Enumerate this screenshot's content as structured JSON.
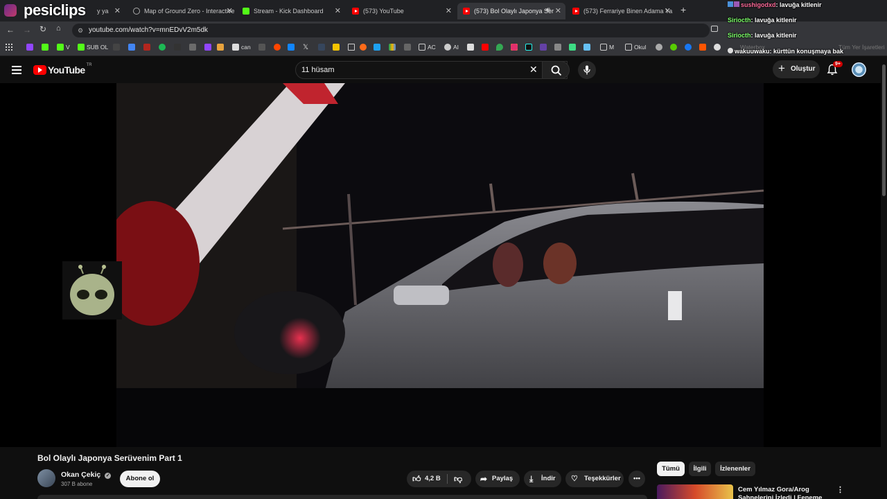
{
  "overlay": {
    "logo_text": "pesiclips"
  },
  "browser": {
    "tabs": [
      {
        "title": "y ya",
        "icon": "youtube-icon"
      },
      {
        "title": "Map of Ground Zero - Interactive",
        "icon": "map-globe-icon"
      },
      {
        "title": "Stream - Kick Dashboard",
        "icon": "kick-icon"
      },
      {
        "title": "(573) YouTube",
        "icon": "youtube-icon"
      },
      {
        "title": "(573) Bol Olaylı Japonya Ser",
        "icon": "youtube-icon"
      },
      {
        "title": "(573) Ferrariye Binen Adama Ya",
        "icon": "youtube-icon"
      }
    ],
    "url": "youtube.com/watch?v=mnEDvV2m5dk",
    "bookmarks": [
      "V",
      "SUB OL",
      "can",
      "AC",
      "AI",
      "M",
      "Okul"
    ],
    "bookmarks_right": [
      "Waterbox",
      "Tüm Yer İşaretleri"
    ]
  },
  "chat": [
    {
      "user": "sushigodxd",
      "text": "lavuğa kitlenir",
      "color": "#ff6b9a"
    },
    {
      "user": "Siriocth",
      "text": "lavuğa kitlenir",
      "color": "#7dff6a"
    },
    {
      "user": "Siriocth",
      "text": "lavuğa kitlenir",
      "color": "#7dff6a"
    },
    {
      "user": "wakuuwaku",
      "text": "kürttün konuşmaya bak",
      "color": "#ffffff"
    }
  ],
  "youtube": {
    "logo": "YouTube",
    "country": "TR",
    "search_value": "11 hüsam",
    "create_label": "Oluştur",
    "notif_badge": "9+"
  },
  "video": {
    "title": "Bol Olaylı Japonya Serüvenim Part 1",
    "channel": "Okan Çekiç",
    "subscribers": "307 B abone",
    "subscribe_label": "Abone ol",
    "likes": "4,2 B",
    "share_label": "Paylaş",
    "download_label": "İndir",
    "thanks_label": "Teşekkürler"
  },
  "sidebar": {
    "chips": [
      "Tümü",
      "İlgili",
      "İzlenenler"
    ],
    "first_video": {
      "title": "Cem Yılmaz Gora/Arog",
      "subtitle": "Sahnelerini İzledi | Feneme"
    }
  },
  "colors": {
    "youtube_red": "#ff0000",
    "kick_green": "#53fc18",
    "page_bg": "#0f0f0f"
  }
}
